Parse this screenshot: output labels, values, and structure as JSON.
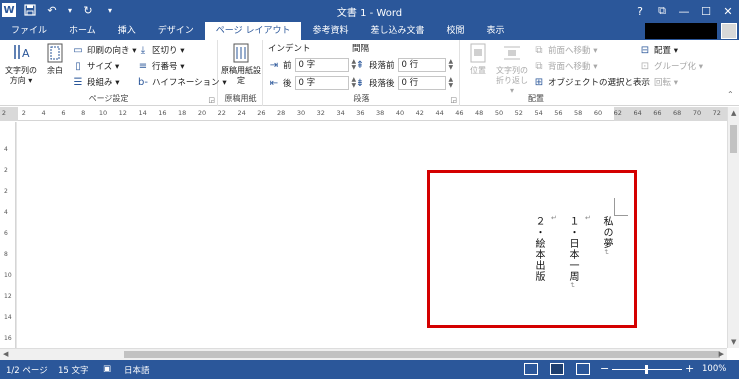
{
  "window": {
    "title": "文書 1 - Word",
    "help": "?",
    "minimize": "—",
    "maximize": "☐",
    "close": "✕",
    "ribbon_options": "⧉"
  },
  "qat": {
    "word_icon": "W",
    "save_icon": "💾",
    "undo_icon": "↶",
    "undo_dropdown": "▾",
    "redo_icon": "↻",
    "customize_icon": "▾"
  },
  "tabs": [
    "ファイル",
    "ホーム",
    "挿入",
    "デザイン",
    "ページ レイアウト",
    "参考資料",
    "差し込み文書",
    "校閲",
    "表示"
  ],
  "ribbon": {
    "page_setup": {
      "label": "ページ設定",
      "text_direction": "文字列の方向 ▾",
      "margins": "余白",
      "orientation": "印刷の向き ▾",
      "size": "サイズ ▾",
      "columns": "段組み ▾",
      "breaks": "区切り ▾",
      "line_numbers": "行番号 ▾",
      "hyphenation": "ハイフネーション ▾"
    },
    "manuscript": {
      "label": "原稿用紙",
      "button": "原稿用紙設定"
    },
    "paragraph": {
      "label": "段落",
      "indent_header": "インデント",
      "spacing_header": "間隔",
      "indent_before_label": "前",
      "indent_before_value": "0 字",
      "indent_after_label": "後",
      "indent_after_value": "0 字",
      "space_before_label": "段落前",
      "space_before_value": "0 行",
      "space_after_label": "段落後",
      "space_after_value": "0 行"
    },
    "arrange": {
      "label": "配置",
      "position": "位置",
      "wrap_text": "文字列の折り返し ▾",
      "bring_forward": "前面へ移動 ▾",
      "send_backward": "背面へ移動 ▾",
      "selection_pane": "オブジェクトの選択と表示",
      "align": "配置 ▾",
      "group": "グループ化 ▾",
      "rotate": "回転 ▾"
    }
  },
  "ruler": {
    "numbers": [
      "2",
      "2",
      "4",
      "6",
      "8",
      "10",
      "12",
      "14",
      "16",
      "18",
      "20",
      "22",
      "24",
      "26",
      "28",
      "30",
      "32",
      "34",
      "36",
      "38",
      "40",
      "42",
      "44",
      "46",
      "48",
      "50",
      "52",
      "54",
      "56",
      "58",
      "60",
      "62",
      "64",
      "66",
      "68",
      "70",
      "72"
    ]
  },
  "vruler": {
    "numbers": [
      "4",
      "2",
      "2",
      "4",
      "6",
      "8",
      "10",
      "12",
      "14",
      "16"
    ]
  },
  "document": {
    "line1": "私の夢",
    "line2": "１・日本一周",
    "line3": "２・絵本出版",
    "para_mark": "↵",
    "highlight_color": "#d40000"
  },
  "status": {
    "page": "1/2 ページ",
    "words": "15 文字",
    "language": "日本語",
    "zoom": "100%",
    "zoom_minus": "−",
    "zoom_plus": "+"
  },
  "colors": {
    "accent": "#2b579a"
  }
}
